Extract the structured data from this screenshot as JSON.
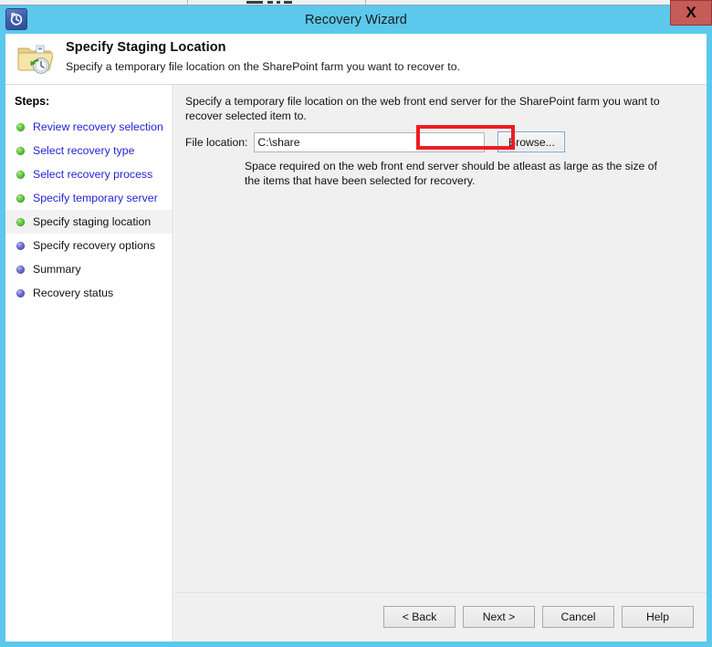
{
  "window": {
    "title": "Recovery Wizard",
    "icon": "recovery-clock-icon",
    "close_label": "X",
    "border_color": "#5bc8ec",
    "close_color": "#c75b57"
  },
  "header": {
    "icon": "folder-recovery-icon",
    "title": "Specify Staging Location",
    "subtitle": "Specify a temporary file location on the SharePoint farm you want to recover to."
  },
  "sidebar": {
    "title": "Steps:",
    "items": [
      {
        "label": "Review recovery selection",
        "state": "done"
      },
      {
        "label": "Select recovery type",
        "state": "done"
      },
      {
        "label": "Select recovery process",
        "state": "done"
      },
      {
        "label": "Specify temporary server",
        "state": "done"
      },
      {
        "label": "Specify staging location",
        "state": "current"
      },
      {
        "label": "Specify recovery options",
        "state": "pending"
      },
      {
        "label": "Summary",
        "state": "pending"
      },
      {
        "label": "Recovery status",
        "state": "pending"
      }
    ]
  },
  "content": {
    "intro": "Specify a temporary file location on the web front end server for the SharePoint farm you want to recover selected item to.",
    "field_label": "File location:",
    "file_location_value": "C:\\share",
    "file_location_placeholder": "",
    "browse_label": "Browse...",
    "note": "Space required on the web front end server should be atleast as large as the size of the items that have been selected for recovery.",
    "highlight_color": "#ee1c22"
  },
  "footer": {
    "back_label": "< Back",
    "next_label": "Next >",
    "cancel_label": "Cancel",
    "help_label": "Help"
  }
}
